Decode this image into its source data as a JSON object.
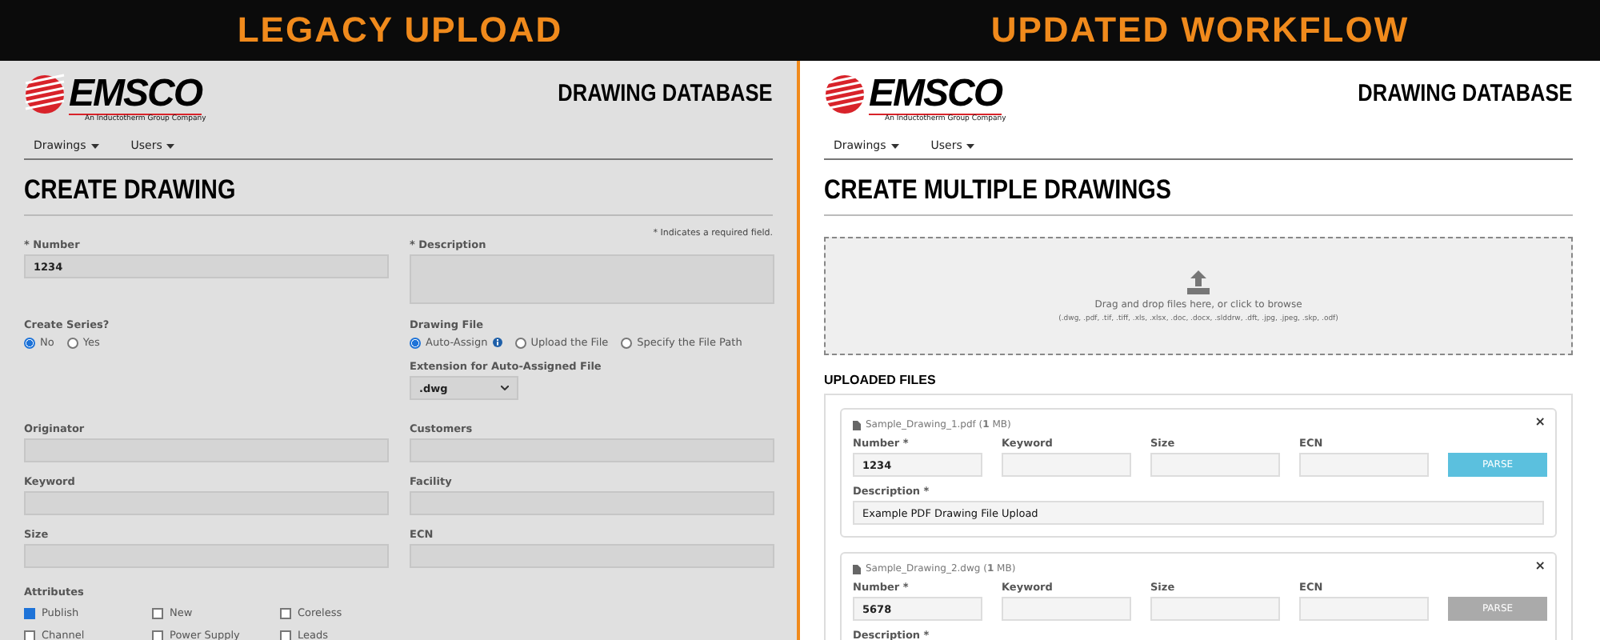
{
  "legacy": {
    "heading": "LEGACY UPLOAD",
    "logo": {
      "name": "EMSCO",
      "tagline": "An Inductotherm Group Company"
    },
    "app_title": "DRAWING DATABASE",
    "nav": [
      "Drawings",
      "Users"
    ],
    "page_title": "CREATE DRAWING",
    "required_note": "* Indicates a required field.",
    "number": {
      "label": "* Number",
      "value": "1234"
    },
    "description": {
      "label": "* Description"
    },
    "create_series": {
      "label": "Create Series?",
      "options": [
        {
          "label": "No",
          "selected": true
        },
        {
          "label": "Yes",
          "selected": false
        }
      ]
    },
    "drawing_file": {
      "label": "Drawing File",
      "options": [
        {
          "label": "Auto-Assign",
          "selected": true,
          "kind": "info"
        },
        {
          "label": "Upload the File",
          "selected": false,
          "kind": "plain"
        },
        {
          "label": "Specify the File Path",
          "selected": false,
          "kind": "plain"
        }
      ]
    },
    "extension": {
      "label": "Extension for Auto-Assigned File",
      "value": ".dwg"
    },
    "fields": [
      {
        "label": "Originator"
      },
      {
        "label": "Customers"
      },
      {
        "label": "Keyword"
      },
      {
        "label": "Facility"
      },
      {
        "label": "Size"
      },
      {
        "label": "ECN"
      }
    ],
    "attributes": {
      "label": "Attributes",
      "items": [
        {
          "label": "Publish",
          "checked": true
        },
        {
          "label": "New",
          "checked": false
        },
        {
          "label": "Coreless",
          "checked": false
        },
        {
          "label": "Channel",
          "checked": false
        },
        {
          "label": "Power Supply",
          "checked": false
        },
        {
          "label": "Leads",
          "checked": false
        }
      ]
    }
  },
  "updated": {
    "heading": "UPDATED WORKFLOW",
    "logo": {
      "name": "EMSCO",
      "tagline": "An Inductotherm Group Company"
    },
    "app_title": "DRAWING DATABASE",
    "nav": [
      "Drawings",
      "Users"
    ],
    "page_title": "CREATE MULTIPLE DRAWINGS",
    "dropzone": {
      "text": "Drag and drop files here, or click to browse",
      "formats": "(.dwg, .pdf, .tif, .tiff, .xls, .xlsx, .doc, .docx, .slddrw, .dft, .jpg, .jpeg, .skp, .odf)"
    },
    "uploaded_title": "UPLOADED FILES",
    "files": [
      {
        "name": "Sample_Drawing_1.pdf (**1** MB)",
        "close": "×",
        "fields": [
          {
            "label": "Number *",
            "value": "1234"
          },
          {
            "label": "Keyword"
          },
          {
            "label": "Size"
          },
          {
            "label": "ECN"
          }
        ],
        "parse": {
          "label": "PARSE",
          "disabled": false
        },
        "description": {
          "label": "Description *",
          "value": "Example PDF Drawing File Upload"
        }
      },
      {
        "name": "Sample_Drawing_2.dwg (**1** MB)",
        "close": "×",
        "fields": [
          {
            "label": "Number *",
            "value": "5678"
          },
          {
            "label": "Keyword"
          },
          {
            "label": "Size"
          },
          {
            "label": "ECN"
          }
        ],
        "parse": {
          "label": "PARSE",
          "disabled": true
        },
        "description": {
          "label": "Description *"
        }
      }
    ]
  }
}
